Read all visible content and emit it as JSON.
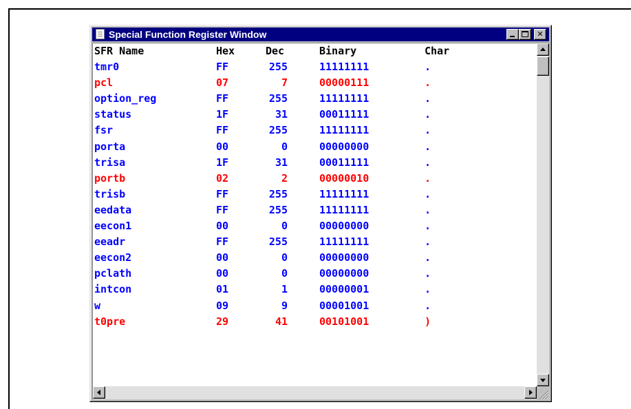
{
  "window": {
    "title": "Special Function Register Window"
  },
  "colors": {
    "normal": "#0000ff",
    "changed": "#ff0000",
    "title_bar": "#000080"
  },
  "columns": [
    "SFR Name",
    "Hex",
    "Dec",
    "Binary",
    "Char"
  ],
  "registers": [
    {
      "name": "tmr0",
      "hex": "FF",
      "dec": "255",
      "bin": "11111111",
      "char": ".",
      "changed": false
    },
    {
      "name": "pcl",
      "hex": "07",
      "dec": "7",
      "bin": "00000111",
      "char": ".",
      "changed": true
    },
    {
      "name": "option_reg",
      "hex": "FF",
      "dec": "255",
      "bin": "11111111",
      "char": ".",
      "changed": false
    },
    {
      "name": "status",
      "hex": "1F",
      "dec": "31",
      "bin": "00011111",
      "char": ".",
      "changed": false
    },
    {
      "name": "fsr",
      "hex": "FF",
      "dec": "255",
      "bin": "11111111",
      "char": ".",
      "changed": false
    },
    {
      "name": "porta",
      "hex": "00",
      "dec": "0",
      "bin": "00000000",
      "char": ".",
      "changed": false
    },
    {
      "name": "trisa",
      "hex": "1F",
      "dec": "31",
      "bin": "00011111",
      "char": ".",
      "changed": false
    },
    {
      "name": "portb",
      "hex": "02",
      "dec": "2",
      "bin": "00000010",
      "char": ".",
      "changed": true
    },
    {
      "name": "trisb",
      "hex": "FF",
      "dec": "255",
      "bin": "11111111",
      "char": ".",
      "changed": false
    },
    {
      "name": "eedata",
      "hex": "FF",
      "dec": "255",
      "bin": "11111111",
      "char": ".",
      "changed": false
    },
    {
      "name": "eecon1",
      "hex": "00",
      "dec": "0",
      "bin": "00000000",
      "char": ".",
      "changed": false
    },
    {
      "name": "eeadr",
      "hex": "FF",
      "dec": "255",
      "bin": "11111111",
      "char": ".",
      "changed": false
    },
    {
      "name": "eecon2",
      "hex": "00",
      "dec": "0",
      "bin": "00000000",
      "char": ".",
      "changed": false
    },
    {
      "name": "pclath",
      "hex": "00",
      "dec": "0",
      "bin": "00000000",
      "char": ".",
      "changed": false
    },
    {
      "name": "intcon",
      "hex": "01",
      "dec": "1",
      "bin": "00000001",
      "char": ".",
      "changed": false
    },
    {
      "name": "w",
      "hex": "09",
      "dec": "9",
      "bin": "00001001",
      "char": ".",
      "changed": false
    },
    {
      "name": "t0pre",
      "hex": "29",
      "dec": "41",
      "bin": "00101001",
      "char": ")",
      "changed": true
    }
  ]
}
